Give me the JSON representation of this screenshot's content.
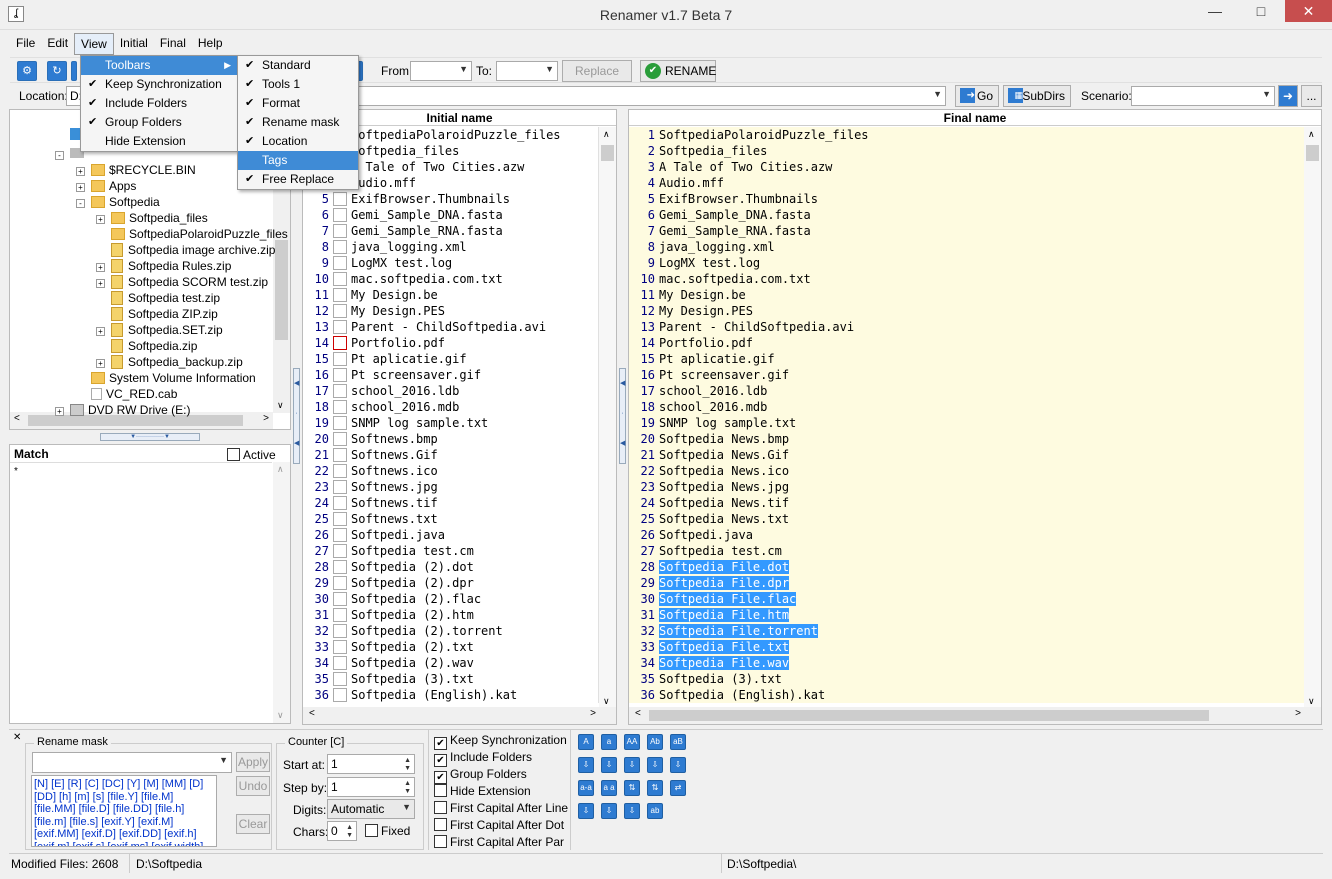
{
  "window": {
    "title": "Renamer v1.7 Beta 7",
    "app_icon": "ʆ"
  },
  "menubar": [
    "File",
    "Edit",
    "View",
    "Initial",
    "Final",
    "Help"
  ],
  "toolbar": {
    "from_label": "From:",
    "to_label": "To:",
    "replace_label": "Replace",
    "rename_label": "RENAME"
  },
  "locationbar": {
    "location_label": "Location:",
    "location_value": "D:",
    "go_label": "Go",
    "subdirs_label": "SubDirs",
    "scenario_label": "Scenario:",
    "more_label": "..."
  },
  "view_menu": {
    "items": [
      {
        "label": "Toolbars",
        "checked": false,
        "submenu": true,
        "highlighted": true
      },
      {
        "label": "Keep Synchronization",
        "checked": true
      },
      {
        "label": "Include Folders",
        "checked": true
      },
      {
        "label": "Group Folders",
        "checked": true
      },
      {
        "label": "Hide Extension",
        "checked": false
      }
    ]
  },
  "toolbars_submenu": {
    "items": [
      {
        "label": "Standard",
        "checked": true
      },
      {
        "label": "Tools 1",
        "checked": true
      },
      {
        "label": "Format",
        "checked": true
      },
      {
        "label": "Rename mask",
        "checked": true
      },
      {
        "label": "Location",
        "checked": true
      },
      {
        "label": "Tags",
        "checked": false,
        "highlighted": true
      },
      {
        "label": "Free Replace",
        "checked": true
      }
    ]
  },
  "tree": {
    "nodes": [
      {
        "label": "$RECYCLE.BIN",
        "indent": 1,
        "type": "folder",
        "exp": "+"
      },
      {
        "label": "Apps",
        "indent": 1,
        "type": "folder",
        "exp": "+"
      },
      {
        "label": "Softpedia",
        "indent": 1,
        "type": "folder",
        "exp": "-"
      },
      {
        "label": "Softpedia_files",
        "indent": 2,
        "type": "folder",
        "exp": "+"
      },
      {
        "label": "SoftpediaPolaroidPuzzle_files",
        "indent": 2,
        "type": "folder",
        "exp": ""
      },
      {
        "label": "Softpedia image archive.zip",
        "indent": 2,
        "type": "zip",
        "exp": ""
      },
      {
        "label": "Softpedia Rules.zip",
        "indent": 2,
        "type": "zip",
        "exp": "+"
      },
      {
        "label": "Softpedia SCORM test.zip",
        "indent": 2,
        "type": "zip",
        "exp": "+"
      },
      {
        "label": "Softpedia test.zip",
        "indent": 2,
        "type": "zip",
        "exp": ""
      },
      {
        "label": "Softpedia ZIP.zip",
        "indent": 2,
        "type": "zip",
        "exp": ""
      },
      {
        "label": "Softpedia.SET.zip",
        "indent": 2,
        "type": "zip",
        "exp": "+"
      },
      {
        "label": "Softpedia.zip",
        "indent": 2,
        "type": "zip",
        "exp": ""
      },
      {
        "label": "Softpedia_backup.zip",
        "indent": 2,
        "type": "zip",
        "exp": "+"
      },
      {
        "label": "System Volume Information",
        "indent": 1,
        "type": "folder",
        "exp": ""
      },
      {
        "label": "VC_RED.cab",
        "indent": 1,
        "type": "file",
        "exp": ""
      },
      {
        "label": "DVD RW Drive (E:)",
        "indent": 0,
        "type": "drive",
        "exp": "+"
      }
    ]
  },
  "match": {
    "title": "Match",
    "active_label": "Active",
    "content": "*"
  },
  "initial": {
    "header": "Initial name",
    "rows": [
      "SoftpediaPolaroidPuzzle_files",
      "Softpedia_files",
      "A Tale of Two Cities.azw",
      "audio.mff",
      "ExifBrowser.Thumbnails",
      "Gemi_Sample_DNA.fasta",
      "Gemi_Sample_RNA.fasta",
      "java_logging.xml",
      "LogMX test.log",
      "mac.softpedia.com.txt",
      "My Design.be",
      "My Design.PES",
      "Parent - ChildSoftpedia.avi",
      "Portfolio.pdf",
      "Pt aplicatie.gif",
      "Pt screensaver.gif",
      "school_2016.ldb",
      "school_2016.mdb",
      "SNMP log sample.txt",
      "Softnews.bmp",
      "Softnews.Gif",
      "Softnews.ico",
      "Softnews.jpg",
      "Softnews.tif",
      "Softnews.txt",
      "Softpedi.java",
      "Softpedia  test.cm",
      "Softpedia (2).dot",
      "Softpedia (2).dpr",
      "Softpedia (2).flac",
      "Softpedia (2).htm",
      "Softpedia (2).torrent",
      "Softpedia (2).txt",
      "Softpedia (2).wav",
      "Softpedia (3).txt",
      "Softpedia (English).kat"
    ]
  },
  "final": {
    "header": "Final name",
    "rows": [
      "SoftpediaPolaroidPuzzle_files",
      "Softpedia_files",
      "A Tale of Two Cities.azw",
      "Audio.mff",
      "ExifBrowser.Thumbnails",
      "Gemi_Sample_DNA.fasta",
      "Gemi_Sample_RNA.fasta",
      "java_logging.xml",
      "LogMX test.log",
      "mac.softpedia.com.txt",
      "My Design.be",
      "My Design.PES",
      "Parent - ChildSoftpedia.avi",
      "Portfolio.pdf",
      "Pt aplicatie.gif",
      "Pt screensaver.gif",
      "school_2016.ldb",
      "school_2016.mdb",
      "SNMP log sample.txt",
      "Softpedia News.bmp",
      "Softpedia News.Gif",
      "Softpedia News.ico",
      "Softpedia News.jpg",
      "Softpedia News.tif",
      "Softpedia News.txt",
      "Softpedi.java",
      "Softpedia  test.cm",
      "Softpedia File.dot",
      "Softpedia File.dpr",
      "Softpedia File.flac",
      "Softpedia File.htm",
      "Softpedia File.torrent",
      "Softpedia File.txt",
      "Softpedia File.wav",
      "Softpedia (3).txt",
      "Softpedia (English).kat"
    ],
    "selected_from": 28,
    "selected_to": 34
  },
  "rename_mask": {
    "caption": "Rename mask",
    "apply": "Apply",
    "undo": "Undo",
    "clear": "Clear",
    "tokens": "[N] [E] [R] [C] [DC] [Y] [M] [MM] [D] [DD] [h] [m] [s] [file.Y] [file.M] [file.MM] [file.D] [file.DD] [file.h] [file.m] [file.s] [exif.Y] [exif.M] [exif.MM] [exif.D] [exif.DD] [exif.h] [exif.m] [exif.s] [exif.ms] [exif.width]"
  },
  "counter": {
    "caption": "Counter [C]",
    "start_label": "Start at:",
    "start_value": "1",
    "step_label": "Step by:",
    "step_value": "1",
    "digits_label": "Digits:",
    "digits_value": "Automatic",
    "chars_label": "Chars:",
    "chars_value": "0",
    "fixed_label": "Fixed"
  },
  "options": [
    {
      "label": "Keep Synchronization",
      "checked": true
    },
    {
      "label": "Include Folders",
      "checked": true
    },
    {
      "label": "Group Folders",
      "checked": true
    },
    {
      "label": "Hide Extension",
      "checked": false
    },
    {
      "label": "First Capital After Line",
      "checked": false
    },
    {
      "label": "First Capital After Dot",
      "checked": false
    },
    {
      "label": "First Capital After Par",
      "checked": false
    }
  ],
  "format_buttons": [
    [
      "A",
      "a",
      "AA",
      "Ab",
      "aB"
    ],
    [
      "⇩",
      "⇩",
      "⇩",
      "⇩",
      "⇩"
    ],
    [
      "a-a",
      "a a",
      "⇅",
      "⇅",
      "⇄"
    ],
    [
      "⇩",
      "⇩",
      "⇩",
      "ab"
    ]
  ],
  "status": {
    "modified": "Modified Files: 2608",
    "path1": "D:\\Softpedia",
    "path2": "D:\\Softpedia\\"
  },
  "colors": {
    "accent": "#3399ff",
    "final_bg": "#fefbe0",
    "row_num": "#000080",
    "icon_blue": "#2e7bd1"
  }
}
